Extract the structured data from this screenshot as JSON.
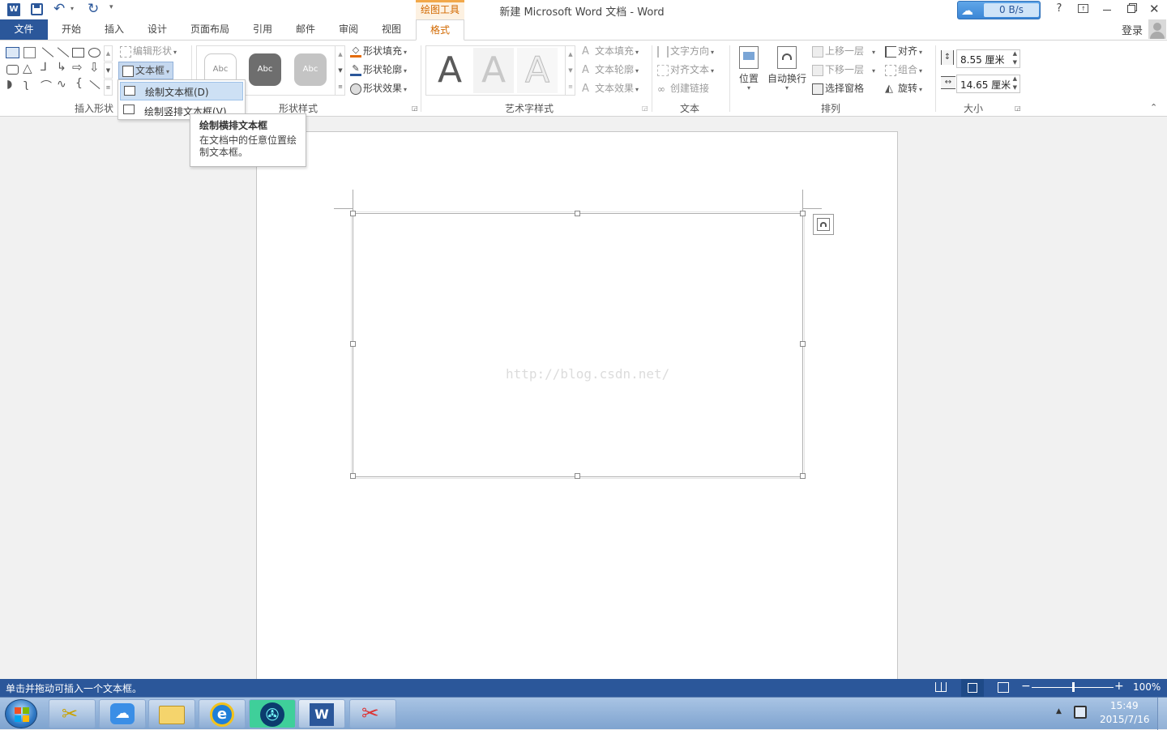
{
  "app": {
    "title": "新建 Microsoft Word 文档 - Word",
    "context_tab_group": "绘图工具",
    "net_speed": "0 B/s",
    "help": "?",
    "login": "登录"
  },
  "tabs": [
    "文件",
    "开始",
    "插入",
    "设计",
    "页面布局",
    "引用",
    "邮件",
    "审阅",
    "视图",
    "格式"
  ],
  "active_tab": "格式",
  "ribbon": {
    "insert_shapes": {
      "label": "插入形状",
      "edit_shape": "编辑形状",
      "textbox": "文本框"
    },
    "shape_styles": {
      "label": "形状样式",
      "style_samples": [
        "Abc",
        "Abc",
        "Abc"
      ],
      "fill": "形状填充",
      "outline": "形状轮廓",
      "effects": "形状效果"
    },
    "wordart": {
      "label": "艺术字样式",
      "samples": [
        "A",
        "A",
        "A"
      ],
      "text_fill": "文本填充",
      "text_outline": "文本轮廓",
      "text_effects": "文本效果"
    },
    "text": {
      "label": "文本",
      "direction": "文字方向",
      "align_text": "对齐文本",
      "create_link": "创建链接"
    },
    "arrange": {
      "label": "排列",
      "position": "位置",
      "wrap": "自动换行",
      "bring_forward": "上移一层",
      "send_backward": "下移一层",
      "selection_pane": "选择窗格",
      "align": "对齐",
      "group": "组合",
      "rotate": "旋转"
    },
    "size": {
      "label": "大小",
      "height": "8.55 厘米",
      "width": "14.65 厘米"
    }
  },
  "textbox_menu": {
    "items": [
      "绘制文本框(D)",
      "绘制竖排文本框(V)"
    ]
  },
  "tooltip": {
    "title": "绘制横排文本框",
    "body": "在文档中的任意位置绘制文本框。"
  },
  "document": {
    "watermark": "http://blog.csdn.net/"
  },
  "status": {
    "message": "单击并拖动可插入一个文本框。",
    "zoom": "100%",
    "zoom_fraction": 0.5
  },
  "taskbar": {
    "time": "15:49",
    "date": "2015/7/16"
  },
  "colors": {
    "accent": "#2b579a",
    "context_tab": "#d26900"
  }
}
